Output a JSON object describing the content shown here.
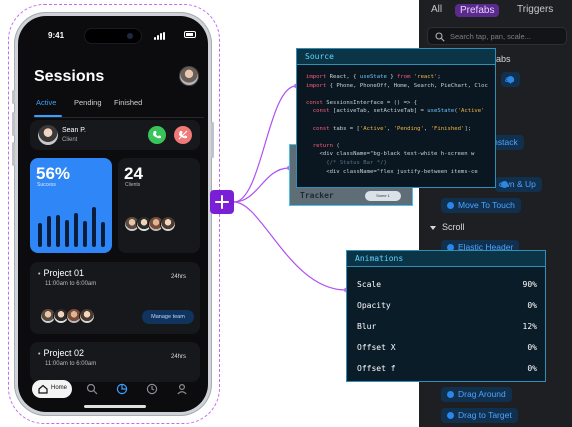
{
  "phone": {
    "time": "9:41",
    "title": "Sessions",
    "tabs": [
      "Active",
      "Pending",
      "Finished"
    ],
    "contact": {
      "name": "Sean P.",
      "role": "Client"
    },
    "stat_success": {
      "value": "56%",
      "label": "Success"
    },
    "stat_clients": {
      "value": "24",
      "label": "Clients"
    },
    "project1": {
      "title": "Project 01",
      "time": "11:00am to 6:00am",
      "hours": "24hrs",
      "button": "Manage team"
    },
    "project2": {
      "title": "Project 02",
      "time": "11:00am to 6:00am",
      "hours": "24hrs"
    },
    "nav_home": "Home",
    "bar_levels": [
      0.55,
      0.7,
      0.72,
      0.62,
      0.78,
      0.58,
      0.9,
      0.56
    ],
    "colors": {
      "accent": "#3aa0ff",
      "call": "#39c45a",
      "hangup": "#f07a78"
    }
  },
  "panel": {
    "tabs": {
      "all": "All",
      "prefabs": "Prefabs",
      "triggers": "Triggers"
    },
    "search_placeholder": "Search tap, pan, scale...",
    "partial_tabs": "abs",
    "partial_tap": "ap",
    "unstack": "Unstack",
    "move_down_up": "own & Up",
    "move_to_touch": "Move To Touch",
    "scroll_label": "Scroll",
    "elastic_header": "Elastic Header",
    "drag_around": "Drag Around",
    "drag_to_target": "Drag to Target"
  },
  "tracker": {
    "label": "Tracker",
    "pill": "Some 1"
  },
  "source": {
    "title": "Source",
    "lines": [
      "import React, { useState } from 'react';",
      "import { Phone, PhoneOff, Home, Search, PieChart, Cloc",
      "",
      "const SessionsInterface = () => {",
      "  const [activeTab, setActiveTab] = useState('Active'",
      "",
      "  const tabs = ['Active', 'Pending', 'Finished'];",
      "",
      "  return (",
      "    <div className=\"bg-black text-white h-screen w",
      "      {/* Status Bar */}",
      "      <div className=\"flex justify-between items-ce"
    ]
  },
  "animations": {
    "title": "Animations",
    "rows": [
      {
        "label": "Scale",
        "value": "90%"
      },
      {
        "label": "Opacity",
        "value": "0%"
      },
      {
        "label": "Blur",
        "value": "12%"
      },
      {
        "label": "Offset X",
        "value": "0%"
      },
      {
        "label": "Offset f",
        "value": "0%"
      }
    ]
  }
}
